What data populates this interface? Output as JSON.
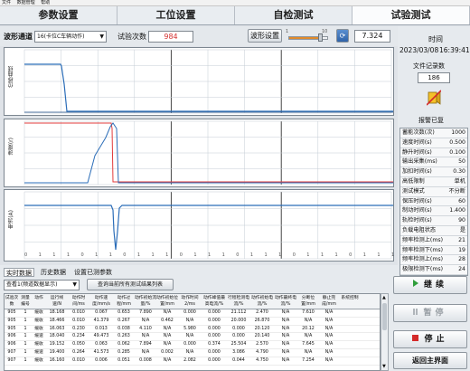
{
  "menubar": [
    "文件",
    "数据管理",
    "帮助"
  ],
  "tabs": [
    "参数设置",
    "工位设置",
    "自检测试",
    "试验测试"
  ],
  "topbar": {
    "channel_label": "波形通道",
    "channel_value": "16(卡位C车辆动作)",
    "count_label": "试验次数",
    "count_value": "984",
    "wave_label": "波形设置",
    "slider_min": "1",
    "slider_max": "10",
    "slider_level": 0.8,
    "right_value": "7.324"
  },
  "time": {
    "label": "时间",
    "date": "2023/03/08",
    "clock": "16:39:41"
  },
  "record": {
    "label": "文件记录数",
    "value": "186"
  },
  "stop_label": "报警已复",
  "params": [
    [
      "蓄能次数(次)",
      "1000"
    ],
    [
      "速度时间(s)",
      "0.500"
    ],
    [
      "静升时间(s)",
      "0.100"
    ],
    [
      "输出采集(ms)",
      "50"
    ],
    [
      "加扣时间(s)",
      "0.30"
    ],
    [
      "高低限制",
      "单机"
    ],
    [
      "测试模式",
      "不分断"
    ],
    [
      "保压时间(s)",
      "60"
    ],
    [
      "制动时间(s)",
      "1.400"
    ],
    [
      "轨检时间(s)",
      "90"
    ],
    [
      "负载电阻状态",
      "是"
    ],
    [
      "频率检测上(ms)",
      "21"
    ],
    [
      "频率检测下(ms)",
      "19"
    ],
    [
      "频率检测上(ms)",
      "28"
    ],
    [
      "极限检测下(ms)",
      "24"
    ]
  ],
  "charts": [
    {
      "ylabel": "位移曲线"
    },
    {
      "ylabel": "速度(r)"
    },
    {
      "ylabel": "电流(A)"
    }
  ],
  "xticks": [
    "0",
    "1",
    "1",
    "1",
    "0",
    "1",
    "1",
    "0",
    "1",
    "1",
    "1",
    "0",
    "1",
    "1",
    "1",
    "0",
    "1",
    "1",
    "1",
    "0",
    "1",
    "1",
    "1",
    "0",
    "1",
    "1",
    "1"
  ],
  "bottom_tabs": [
    "实时数据",
    "历史数据",
    "设置已测参数"
  ],
  "combo1": "查看1(频道数据显示)",
  "search_button": "查询当前所有测试结果列表",
  "table": {
    "headers": [
      "试验次数",
      "测量编号",
      "动作",
      "运行线速/N",
      "动作时间/ms",
      "动作速度/mm/s",
      "动作过程/mm",
      "动作初始流量/%",
      "动作初始位置/mm",
      "动作时间2/ms",
      "动作峰值最高电流/%",
      "行程检测电流/%",
      "动作初始电流/%",
      "动作最终电流/%",
      "分断位置/mm",
      "静止完成/mm",
      "系统控制"
    ],
    "rows": [
      [
        "905",
        "1",
        "缓收",
        "18.168",
        "0.010",
        "0.067",
        "0.653",
        "7.890",
        "N/A",
        "0.000",
        "0.000",
        "21.112",
        "2.470",
        "N/A",
        "7.610",
        "N/A"
      ],
      [
        "905",
        "1",
        "缓收",
        "18.466",
        "0.010",
        "41.379",
        "0.267",
        "N/A",
        "0.462",
        "N/A",
        "0.000",
        "20.000",
        "26.870",
        "N/A",
        "N/A",
        "N/A"
      ],
      [
        "905",
        "1",
        "缓收",
        "16.063",
        "0.230",
        "0.013",
        "0.038",
        "4.110",
        "N/A",
        "5.980",
        "0.000",
        "0.000",
        "20.120",
        "N/A",
        "20.12",
        "N/A"
      ],
      [
        "906",
        "1",
        "缓速",
        "18.040",
        "0.234",
        "49.473",
        "0.263",
        "N/A",
        "N/A",
        "N/A",
        "0.000",
        "0.000",
        "20.140",
        "N/A",
        "N/A",
        "N/A"
      ],
      [
        "906",
        "1",
        "缓收",
        "19.152",
        "0.050",
        "0.063",
        "0.062",
        "7.894",
        "N/A",
        "0.000",
        "0.374",
        "25.504",
        "2.570",
        "N/A",
        "7.645",
        "N/A"
      ],
      [
        "907",
        "1",
        "缓速",
        "19.400",
        "0.264",
        "41.573",
        "0.285",
        "N/A",
        "0.002",
        "N/A",
        "0.000",
        "3.086",
        "4.790",
        "N/A",
        "N/A",
        "N/A"
      ],
      [
        "907",
        "1",
        "缓收",
        "16.160",
        "0.010",
        "0.006",
        "0.051",
        "0.008",
        "N/A",
        "2.082",
        "0.000",
        "0.044",
        "4.750",
        "N/A",
        "7.254",
        "N/A"
      ]
    ]
  },
  "buttons": {
    "continue": "继续",
    "pause": "暂停",
    "stop": "停止",
    "home": "返回主界面"
  },
  "colors": {
    "trace_blue": "#2b6db8",
    "trace_red": "#e23b3b",
    "grid": "#c4ccd4",
    "pause_disabled": "#9aa0a6"
  }
}
